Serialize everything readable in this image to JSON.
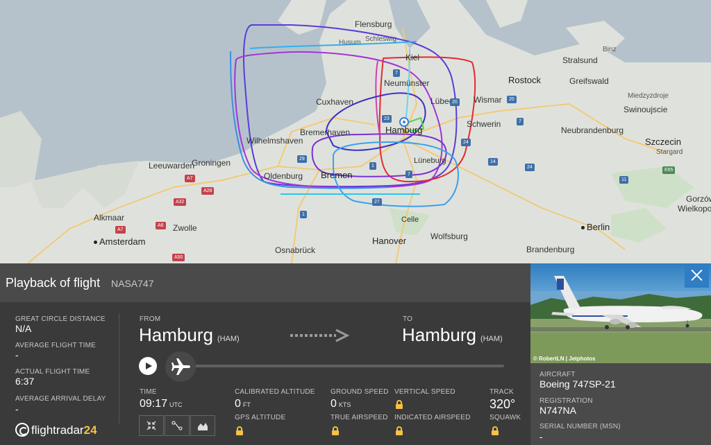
{
  "map": {
    "cities": [
      {
        "name": "Flensburg",
        "cls": "city"
      },
      {
        "name": "Schleswig",
        "cls": "city muted"
      },
      {
        "name": "Husum",
        "cls": "city muted"
      },
      {
        "name": "Kiel",
        "cls": "city"
      },
      {
        "name": "Neumünster",
        "cls": "city"
      },
      {
        "name": "Cuxhaven",
        "cls": "city"
      },
      {
        "name": "Lübeck",
        "cls": "city"
      },
      {
        "name": "Wismar",
        "cls": "city"
      },
      {
        "name": "Rostock",
        "cls": "city big"
      },
      {
        "name": "Stralsund",
        "cls": "city"
      },
      {
        "name": "Greifswald",
        "cls": "city"
      },
      {
        "name": "Binz",
        "cls": "city muted"
      },
      {
        "name": "Miedzyzdroje",
        "cls": "city muted"
      },
      {
        "name": "Swinoujscie",
        "cls": "city"
      },
      {
        "name": "Bremerhaven",
        "cls": "city"
      },
      {
        "name": "Hamburg",
        "cls": "city big"
      },
      {
        "name": "Schwerin",
        "cls": "city"
      },
      {
        "name": "Neubrandenburg",
        "cls": "city"
      },
      {
        "name": "Szczecin",
        "cls": "city big"
      },
      {
        "name": "Stargard",
        "cls": "city muted"
      },
      {
        "name": "Wilhelmshaven",
        "cls": "city"
      },
      {
        "name": "Leeuwarden",
        "cls": "city"
      },
      {
        "name": "Groningen",
        "cls": "city"
      },
      {
        "name": "Lüneburg",
        "cls": "city"
      },
      {
        "name": "Gorzów",
        "cls": "city"
      },
      {
        "name": "Wielkopolski",
        "cls": "city"
      },
      {
        "name": "Oldenburg",
        "cls": "city"
      },
      {
        "name": "Bremen",
        "cls": "city big"
      },
      {
        "name": "Alkmaar",
        "cls": "city"
      },
      {
        "name": "Zwolle",
        "cls": "city"
      },
      {
        "name": "Celle",
        "cls": "city"
      },
      {
        "name": "Berlin",
        "cls": "city big dot"
      },
      {
        "name": "Amsterdam",
        "cls": "city big dot"
      },
      {
        "name": "Osnabrück",
        "cls": "city"
      },
      {
        "name": "Hanover",
        "cls": "city big"
      },
      {
        "name": "Wolfsburg",
        "cls": "city"
      },
      {
        "name": "Brandenburg",
        "cls": "city"
      }
    ],
    "shields": [
      {
        "text": "7",
        "cls": "shield blue"
      },
      {
        "text": "23",
        "cls": "shield blue"
      },
      {
        "text": "20",
        "cls": "shield blue"
      },
      {
        "text": "20",
        "cls": "shield blue"
      },
      {
        "text": "7",
        "cls": "shield blue"
      },
      {
        "text": "24",
        "cls": "shield blue"
      },
      {
        "text": "14",
        "cls": "shield blue"
      },
      {
        "text": "24",
        "cls": "shield blue"
      },
      {
        "text": "11",
        "cls": "shield blue"
      },
      {
        "text": "29",
        "cls": "shield blue"
      },
      {
        "text": "1",
        "cls": "shield blue"
      },
      {
        "text": "27",
        "cls": "shield blue"
      },
      {
        "text": "7",
        "cls": "shield blue"
      },
      {
        "text": "1",
        "cls": "shield blue"
      },
      {
        "text": "A7",
        "cls": "shield red"
      },
      {
        "text": "A28",
        "cls": "shield red"
      },
      {
        "text": "A32",
        "cls": "shield red"
      },
      {
        "text": "A7",
        "cls": "shield red"
      },
      {
        "text": "A6",
        "cls": "shield red"
      },
      {
        "text": "A50",
        "cls": "shield red"
      },
      {
        "text": "E65",
        "cls": "shield green"
      }
    ]
  },
  "panel": {
    "title": "Playback of flight",
    "callsign": "NASA747",
    "stats": [
      {
        "label": "Great Circle Distance",
        "value": "N/A"
      },
      {
        "label": "Average Flight Time",
        "value": "-"
      },
      {
        "label": "Actual Flight Time",
        "value": "6:37"
      },
      {
        "label": "Average Arrival Delay",
        "value": "-"
      }
    ],
    "from_label": "From",
    "from_city": "Hamburg",
    "from_code": "(HAM)",
    "to_label": "To",
    "to_city": "Hamburg",
    "to_code": "(HAM)",
    "time_label": "Time",
    "time_value": "09:17",
    "time_unit": "UTC",
    "cal_alt_label": "Calibrated Altitude",
    "cal_alt_value": "0",
    "cal_alt_unit": "FT",
    "gps_alt_label": "GPS Altitude",
    "ground_speed_label": "Ground Speed",
    "ground_speed_value": "0",
    "ground_speed_unit": "KTS",
    "true_airspeed_label": "True Airspeed",
    "vertical_speed_label": "Vertical Speed",
    "indicated_airspeed_label": "Indicated Airspeed",
    "track_label": "Track",
    "track_value": "320°",
    "squawk_label": "Squawk",
    "logo_text": "flightradar",
    "logo_num": "24"
  },
  "aircraft": {
    "photo_credit": "© RobertLN | Jetphotos",
    "aircraft_label": "Aircraft",
    "aircraft_value": "Boeing 747SP-21",
    "registration_label": "Registration",
    "registration_value": "N747NA",
    "serial_label": "Serial Number (MSN)",
    "serial_value": "-"
  },
  "colors": {
    "panel_bg": "#3a3a3a",
    "header_bg": "#4a4a4a",
    "close_button": "#2f7dc4",
    "lock": "#f5c242",
    "logo_accent": "#f5c242"
  }
}
